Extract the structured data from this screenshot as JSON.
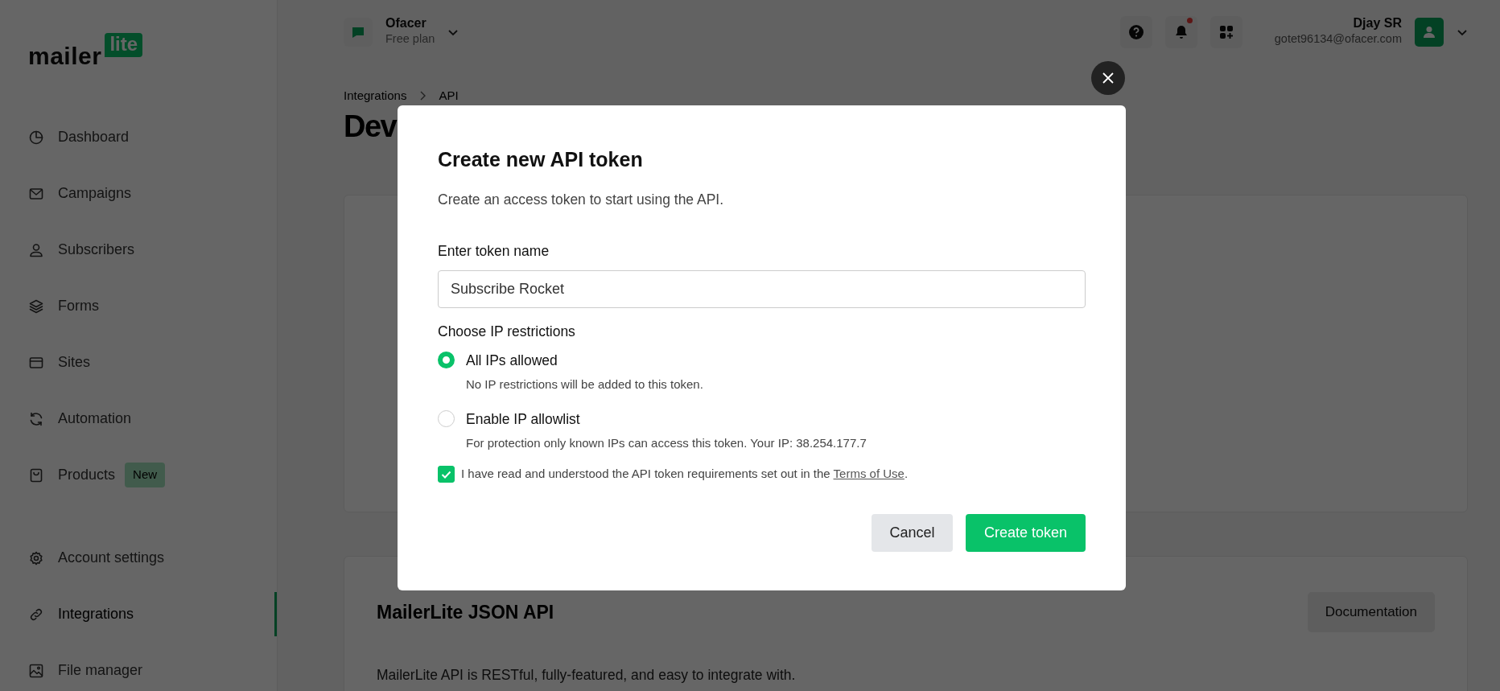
{
  "sidebar": {
    "logo": {
      "word": "mailer",
      "badge": "lite"
    },
    "items": [
      {
        "label": "Dashboard",
        "selected": false
      },
      {
        "label": "Campaigns",
        "selected": false
      },
      {
        "label": "Subscribers",
        "selected": false
      },
      {
        "label": "Forms",
        "selected": false
      },
      {
        "label": "Sites",
        "selected": false
      },
      {
        "label": "Automation",
        "selected": false
      },
      {
        "label": "Products",
        "selected": false,
        "badge": "New"
      }
    ],
    "bottom_items": [
      {
        "label": "Account settings",
        "selected": false
      },
      {
        "label": "Integrations",
        "selected": true
      },
      {
        "label": "File manager",
        "selected": false
      }
    ]
  },
  "header": {
    "workspace": {
      "name": "Ofacer",
      "plan": "Free plan"
    },
    "notifications_unread": true,
    "user": {
      "name": "Djay SR",
      "email": "gotet96134@ofacer.com"
    }
  },
  "breadcrumb": [
    "Integrations",
    "API"
  ],
  "page_title": "Dev",
  "api_card": {
    "title": "MailerLite JSON API",
    "button": "Documentation",
    "description": "MailerLite API is RESTful, fully-featured, and easy to integrate with."
  },
  "modal": {
    "title": "Create new API token",
    "subtitle": "Create an access token to start using the API.",
    "field_label": "Enter token name",
    "field_value": "Subscribe Rocket",
    "restrictions_label": "Choose IP restrictions",
    "options": [
      {
        "label": "All IPs allowed",
        "hint": "No IP restrictions will be added to this token.",
        "selected": true
      },
      {
        "label": "Enable IP allowlist",
        "hint": "For protection only known IPs can access this token. Your IP: 38.254.177.7",
        "selected": false
      }
    ],
    "agreement": {
      "checked": true,
      "text": "I have read and understood the API token requirements set out in the ",
      "link": "Terms of Use",
      "end": "."
    },
    "buttons": [
      {
        "label": "Cancel",
        "kind": "secondary"
      },
      {
        "label": "Create token",
        "kind": "primary"
      }
    ]
  }
}
